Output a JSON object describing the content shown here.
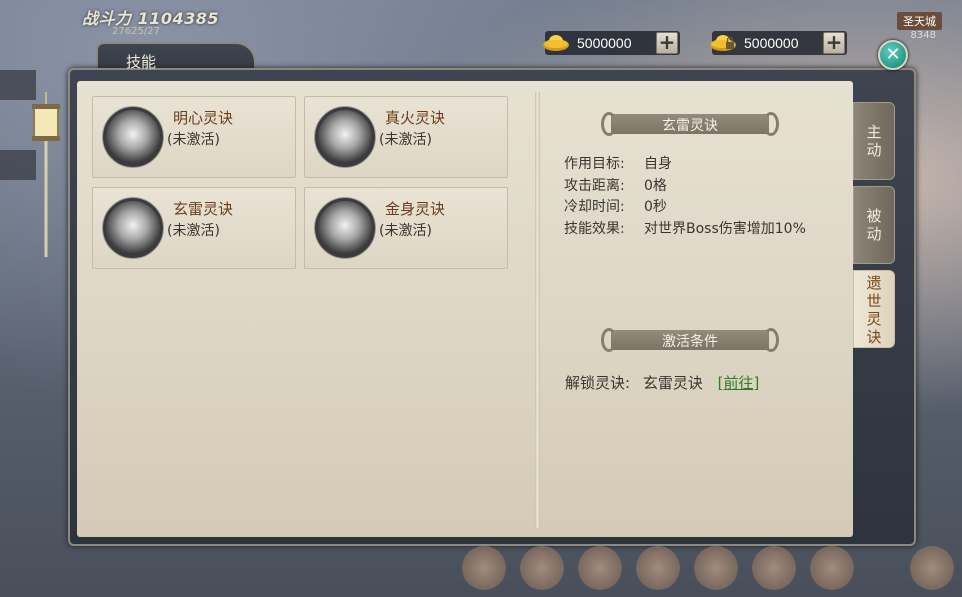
{
  "header": {
    "power_label": "战斗力 1104385",
    "power_sub": "27625/27",
    "top_right_badge": "圣天城",
    "top_right_sub": "8348"
  },
  "currencies": [
    {
      "icon": "gold-ingot-icon",
      "amount": "5000000"
    },
    {
      "icon": "locked-gold-ingot-icon",
      "amount": "5000000"
    }
  ],
  "window": {
    "title": "技能"
  },
  "skills": [
    {
      "name": "明心灵诀",
      "status": "(未激活)",
      "icon": "mingxin-skill-icon"
    },
    {
      "name": "真火灵诀",
      "status": "(未激活)",
      "icon": "zhenhuo-skill-icon"
    },
    {
      "name": "玄雷灵诀",
      "status": "(未激活)",
      "icon": "xuanlei-skill-icon"
    },
    {
      "name": "金身灵诀",
      "status": "(未激活)",
      "icon": "jinshen-skill-icon"
    }
  ],
  "detail": {
    "title": "玄雷灵诀",
    "rows": [
      {
        "label": "作用目标:",
        "value": "自身"
      },
      {
        "label": "攻击距离:",
        "value": "0格"
      },
      {
        "label": "冷却时间:",
        "value": "0秒"
      },
      {
        "label": "技能效果:",
        "value": "对世界Boss伤害增加10%"
      }
    ],
    "condition_title": "激活条件",
    "unlock_label": "解锁灵诀:",
    "unlock_value": "玄雷灵诀",
    "unlock_link": "[前往]"
  },
  "side_tabs": [
    {
      "label": "主动",
      "active": false
    },
    {
      "label": "被动",
      "active": false
    },
    {
      "label": "遗世灵诀",
      "active": true
    }
  ],
  "colors": {
    "skill_name": "#6a3e1c",
    "link": "#2f7d20",
    "active_tab_text": "#7a4818",
    "close_button": "#11806f"
  }
}
